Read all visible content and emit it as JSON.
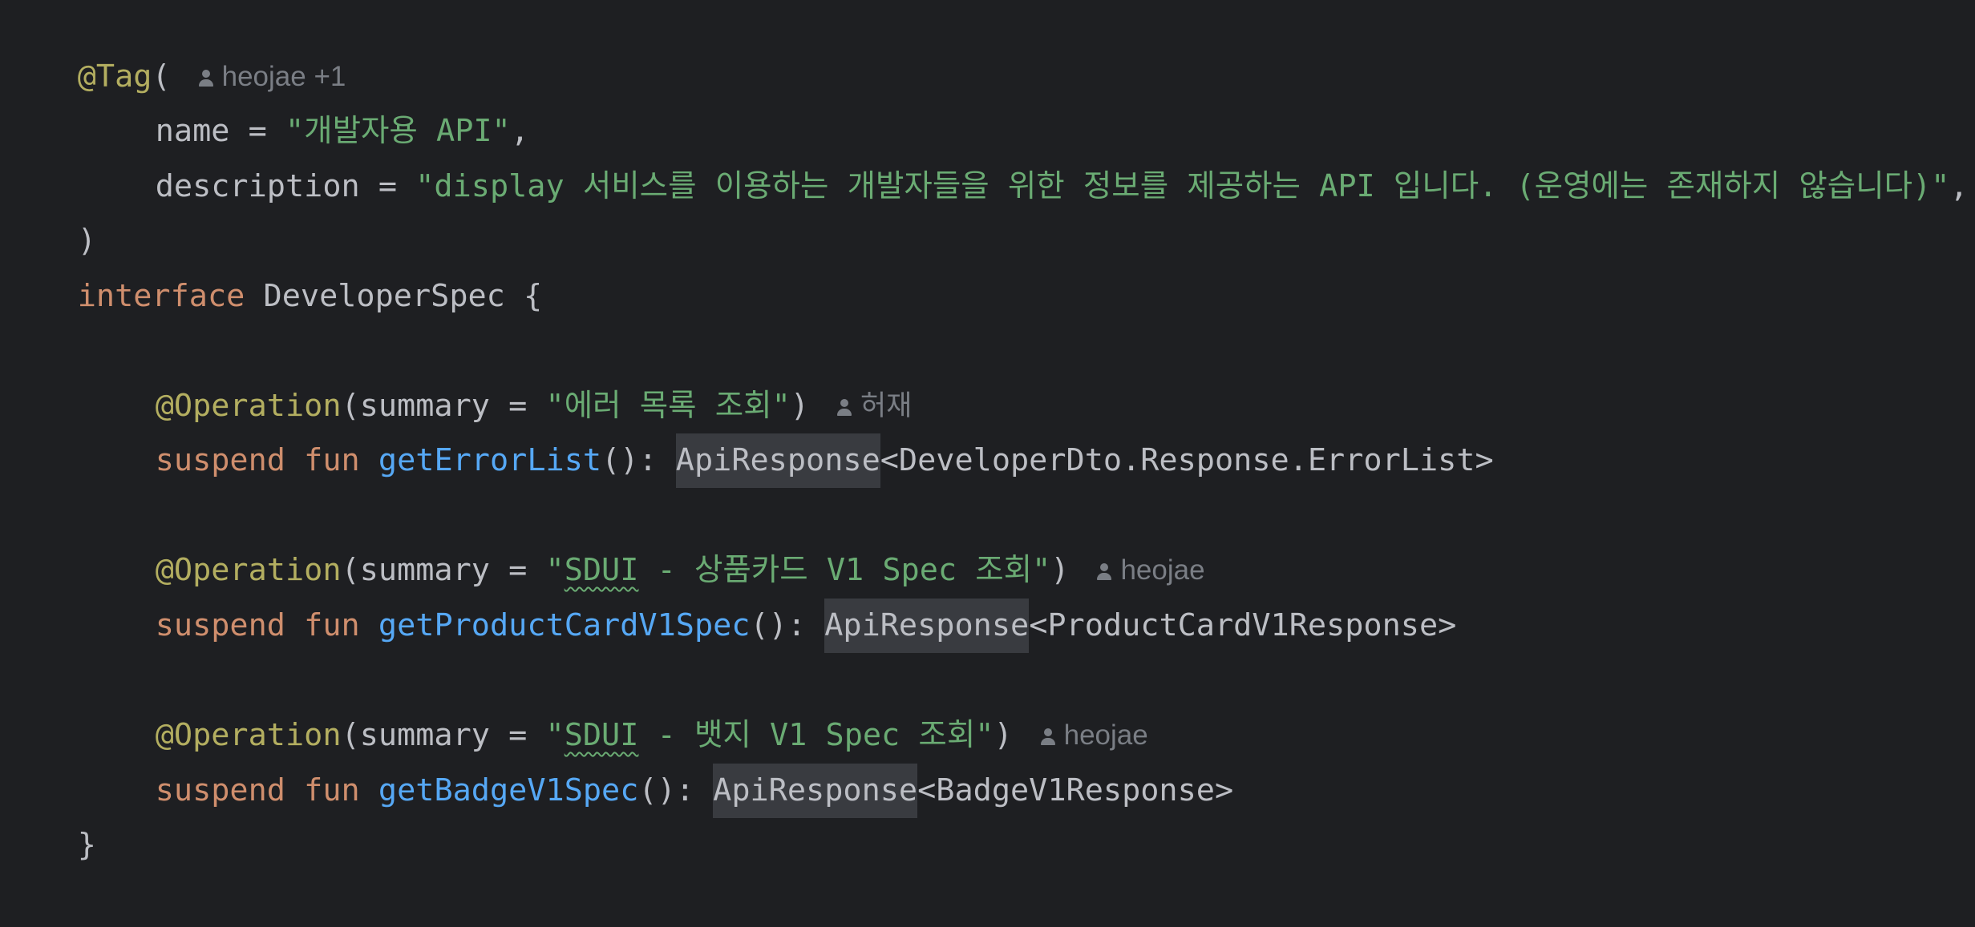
{
  "editor": {
    "tag_annotation": "@Tag",
    "tag_open": "(",
    "tag_author": "heojae +1",
    "name_key": "name",
    "name_value": "\"개발자용 API\"",
    "description_key": "description",
    "description_value": "\"display 서비스를 이용하는 개발자들을 위한 정보를 제공하는 API 입니다. (운영에는 존재하지 않습니다)\"",
    "tag_close": ")",
    "interface_keyword": "interface",
    "interface_name": "DeveloperSpec",
    "open_brace": "{",
    "close_brace": "}",
    "operation_annotation": "@Operation",
    "summary_key": "summary",
    "suspend_keyword": "suspend",
    "fun_keyword": "fun",
    "api_response_type": "ApiResponse",
    "methods": [
      {
        "summary_text": "\"에러 목록 조회\"",
        "author": "허재",
        "function_name": "getErrorList",
        "generic_type": "<DeveloperDto.Response.ErrorList>"
      },
      {
        "summary_quote": "\"",
        "summary_typo": "SDUI",
        "summary_rest": " - 상품카드 V1 Spec 조회\"",
        "author": "heojae",
        "function_name": "getProductCardV1Spec",
        "generic_type": "<ProductCardV1Response>"
      },
      {
        "summary_quote": "\"",
        "summary_typo": "SDUI",
        "summary_rest": " - 뱃지 V1 Spec 조회\"",
        "author": "heojae",
        "function_name": "getBadgeV1Spec",
        "generic_type": "<BadgeV1Response>"
      }
    ]
  },
  "icons": {
    "author": "person-icon"
  },
  "colors": {
    "background": "#1e1f22",
    "default_text": "#bcbec4",
    "annotation": "#b3ae60",
    "keyword": "#cf8e6d",
    "string": "#6aab73",
    "function": "#56a8f5",
    "inlay_hint": "#7a7e85",
    "highlight": "#393b40"
  }
}
